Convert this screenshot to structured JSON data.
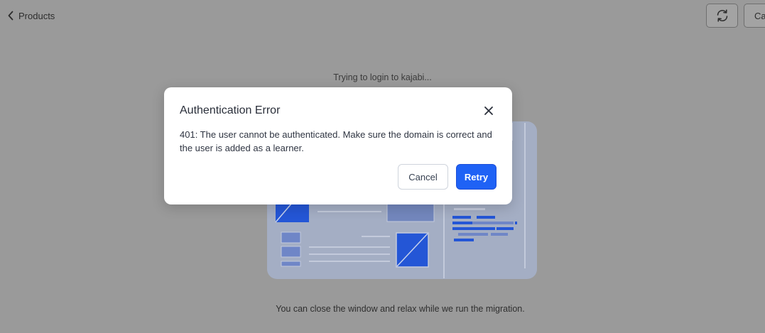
{
  "header": {
    "back_label": "Products",
    "cancel_label": "Ca"
  },
  "status": {
    "loading_text": "Trying to login to kajabi..."
  },
  "footer": {
    "message": "You can close the window and relax while we run the migration."
  },
  "dialog": {
    "title": "Authentication Error",
    "message": "401: The user cannot be authenticated. Make sure the domain is correct and the user is added as a learner.",
    "cancel_label": "Cancel",
    "retry_label": "Retry"
  },
  "icons": {
    "back": "chevron-left-icon",
    "refresh": "refresh-icon",
    "close": "close-icon"
  },
  "colors": {
    "overlay": "#9a9a9a",
    "primary": "#1f62f5",
    "illustration_fill": "#a4aec4",
    "illustration_accent": "#2456d6"
  }
}
